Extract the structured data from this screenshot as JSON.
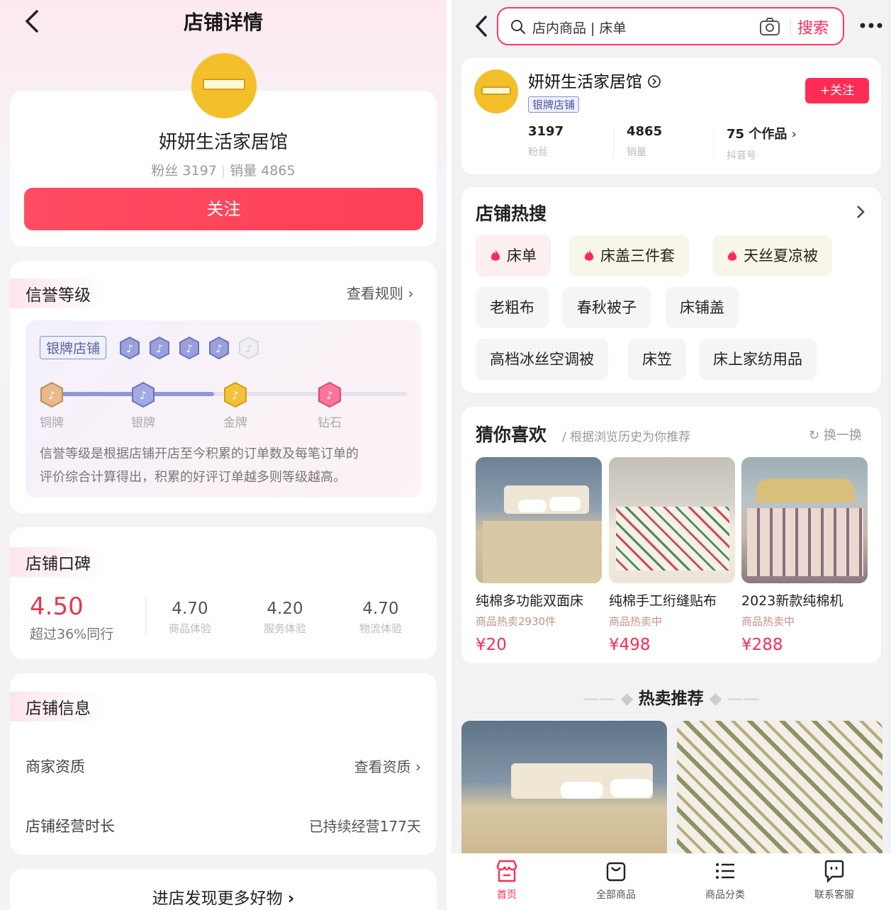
{
  "left": {
    "header": {
      "title": "店铺详情"
    },
    "shop": {
      "name": "妍妍生活家居馆",
      "fans_label": "粉丝 3197",
      "sales_label": "销量 4865",
      "follow_label": "关注"
    },
    "credit": {
      "title": "信誉等级",
      "rules_link": "查看规则",
      "tag": "银牌店铺",
      "levels": [
        "铜牌",
        "银牌",
        "金牌",
        "钻石"
      ],
      "desc_line1": "信誉等级是根据店铺开店至今积累的订单数及每笔订单的",
      "desc_line2": "评价综合计算得出，积累的好评订单越多则等级越高。"
    },
    "reputation": {
      "title": "店铺口碑",
      "score": "4.50",
      "score_sub": "超过36%同行",
      "items": [
        {
          "value": "4.70",
          "label": "商品体验"
        },
        {
          "value": "4.20",
          "label": "服务体验"
        },
        {
          "value": "4.70",
          "label": "物流体验"
        }
      ]
    },
    "info": {
      "title": "店铺信息",
      "qual_label": "商家资质",
      "qual_link": "查看资质",
      "duration_label": "店铺经营时长",
      "duration_value": "已持续经营177天"
    },
    "bottom_link": "进店发现更多好物"
  },
  "right": {
    "search": {
      "placeholder": "店内商品 | 床单",
      "button": "搜索"
    },
    "shop": {
      "name": "妍妍生活家居馆",
      "badge": "银牌店铺",
      "follow": "+关注",
      "stats": [
        {
          "value": "3197",
          "label": "粉丝"
        },
        {
          "value": "4865",
          "label": "销量"
        },
        {
          "value": "75 个作品",
          "label": "抖音号"
        }
      ]
    },
    "hot_search": {
      "title": "店铺热搜",
      "row1": [
        "床单",
        "床盖三件套",
        "天丝夏凉被"
      ],
      "row2": [
        "老粗布",
        "春秋被子",
        "床铺盖"
      ],
      "row3": [
        "高档冰丝空调被",
        "床笠",
        "床上家纺用品"
      ]
    },
    "guess": {
      "title": "猜你喜欢",
      "subtitle": "/ 根据浏览历史为你推荐",
      "refresh": "换一换",
      "products": [
        {
          "name": "纯棉多功能双面床",
          "sold": "商品热卖2930件",
          "price": "¥20"
        },
        {
          "name": "纯棉手工绗缝贴布",
          "sold": "商品热卖中",
          "price": "¥498"
        },
        {
          "name": "2023新款纯棉机",
          "sold": "商品热卖中",
          "price": "¥288"
        }
      ]
    },
    "hot_rec_title": "热卖推荐",
    "tabs": [
      "首页",
      "全部商品",
      "商品分类",
      "联系客服"
    ]
  },
  "colors": {
    "accent": "#fe2c55",
    "gold": "#f3bf2a",
    "silver_badge": "#5b60a8"
  }
}
